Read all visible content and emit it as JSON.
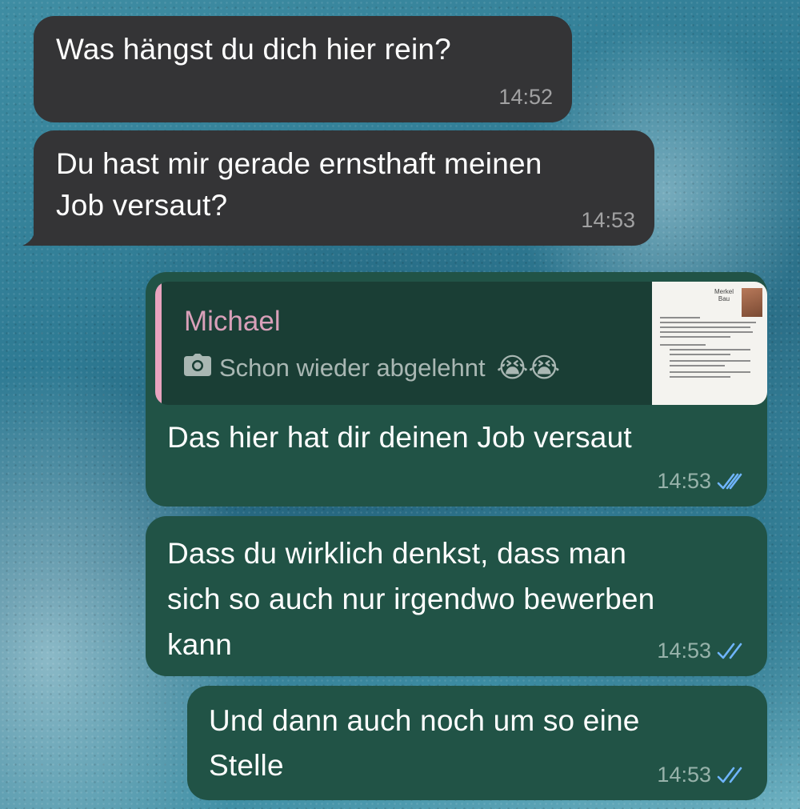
{
  "messages": [
    {
      "text": "Was hängst du dich hier rein?",
      "time": "14:52",
      "direction": "incoming"
    },
    {
      "text_line1": "Du hast mir gerade ernsthaft meinen",
      "text_line2": "Job versaut?",
      "time": "14:53",
      "direction": "incoming"
    },
    {
      "reply": {
        "author": "Michael",
        "media_icon": "camera-icon",
        "preview_text": "Schon wieder abgelehnt",
        "emoji": "😭😭",
        "thumbnail_logo": "Merkel Bau"
      },
      "text": "Das hier hat dir deinen Job versaut",
      "time": "14:53",
      "status": "read",
      "direction": "outgoing"
    },
    {
      "text_line1": "Dass du wirklich denkst, dass man",
      "text_line2": "sich so auch nur irgendwo bewerben",
      "text_line3": "kann",
      "time": "14:53",
      "status": "read",
      "direction": "outgoing"
    },
    {
      "text_line1": "Und dann auch noch um so eine",
      "text_line2": "Stelle",
      "time": "14:53",
      "status": "read",
      "direction": "outgoing"
    }
  ],
  "colors": {
    "incoming_bubble": "#343436",
    "outgoing_bubble": "#215346",
    "read_ticks": "#6fb5ff",
    "quote_author": "#d9a0b9",
    "quote_bar": "#e8a4bf"
  }
}
